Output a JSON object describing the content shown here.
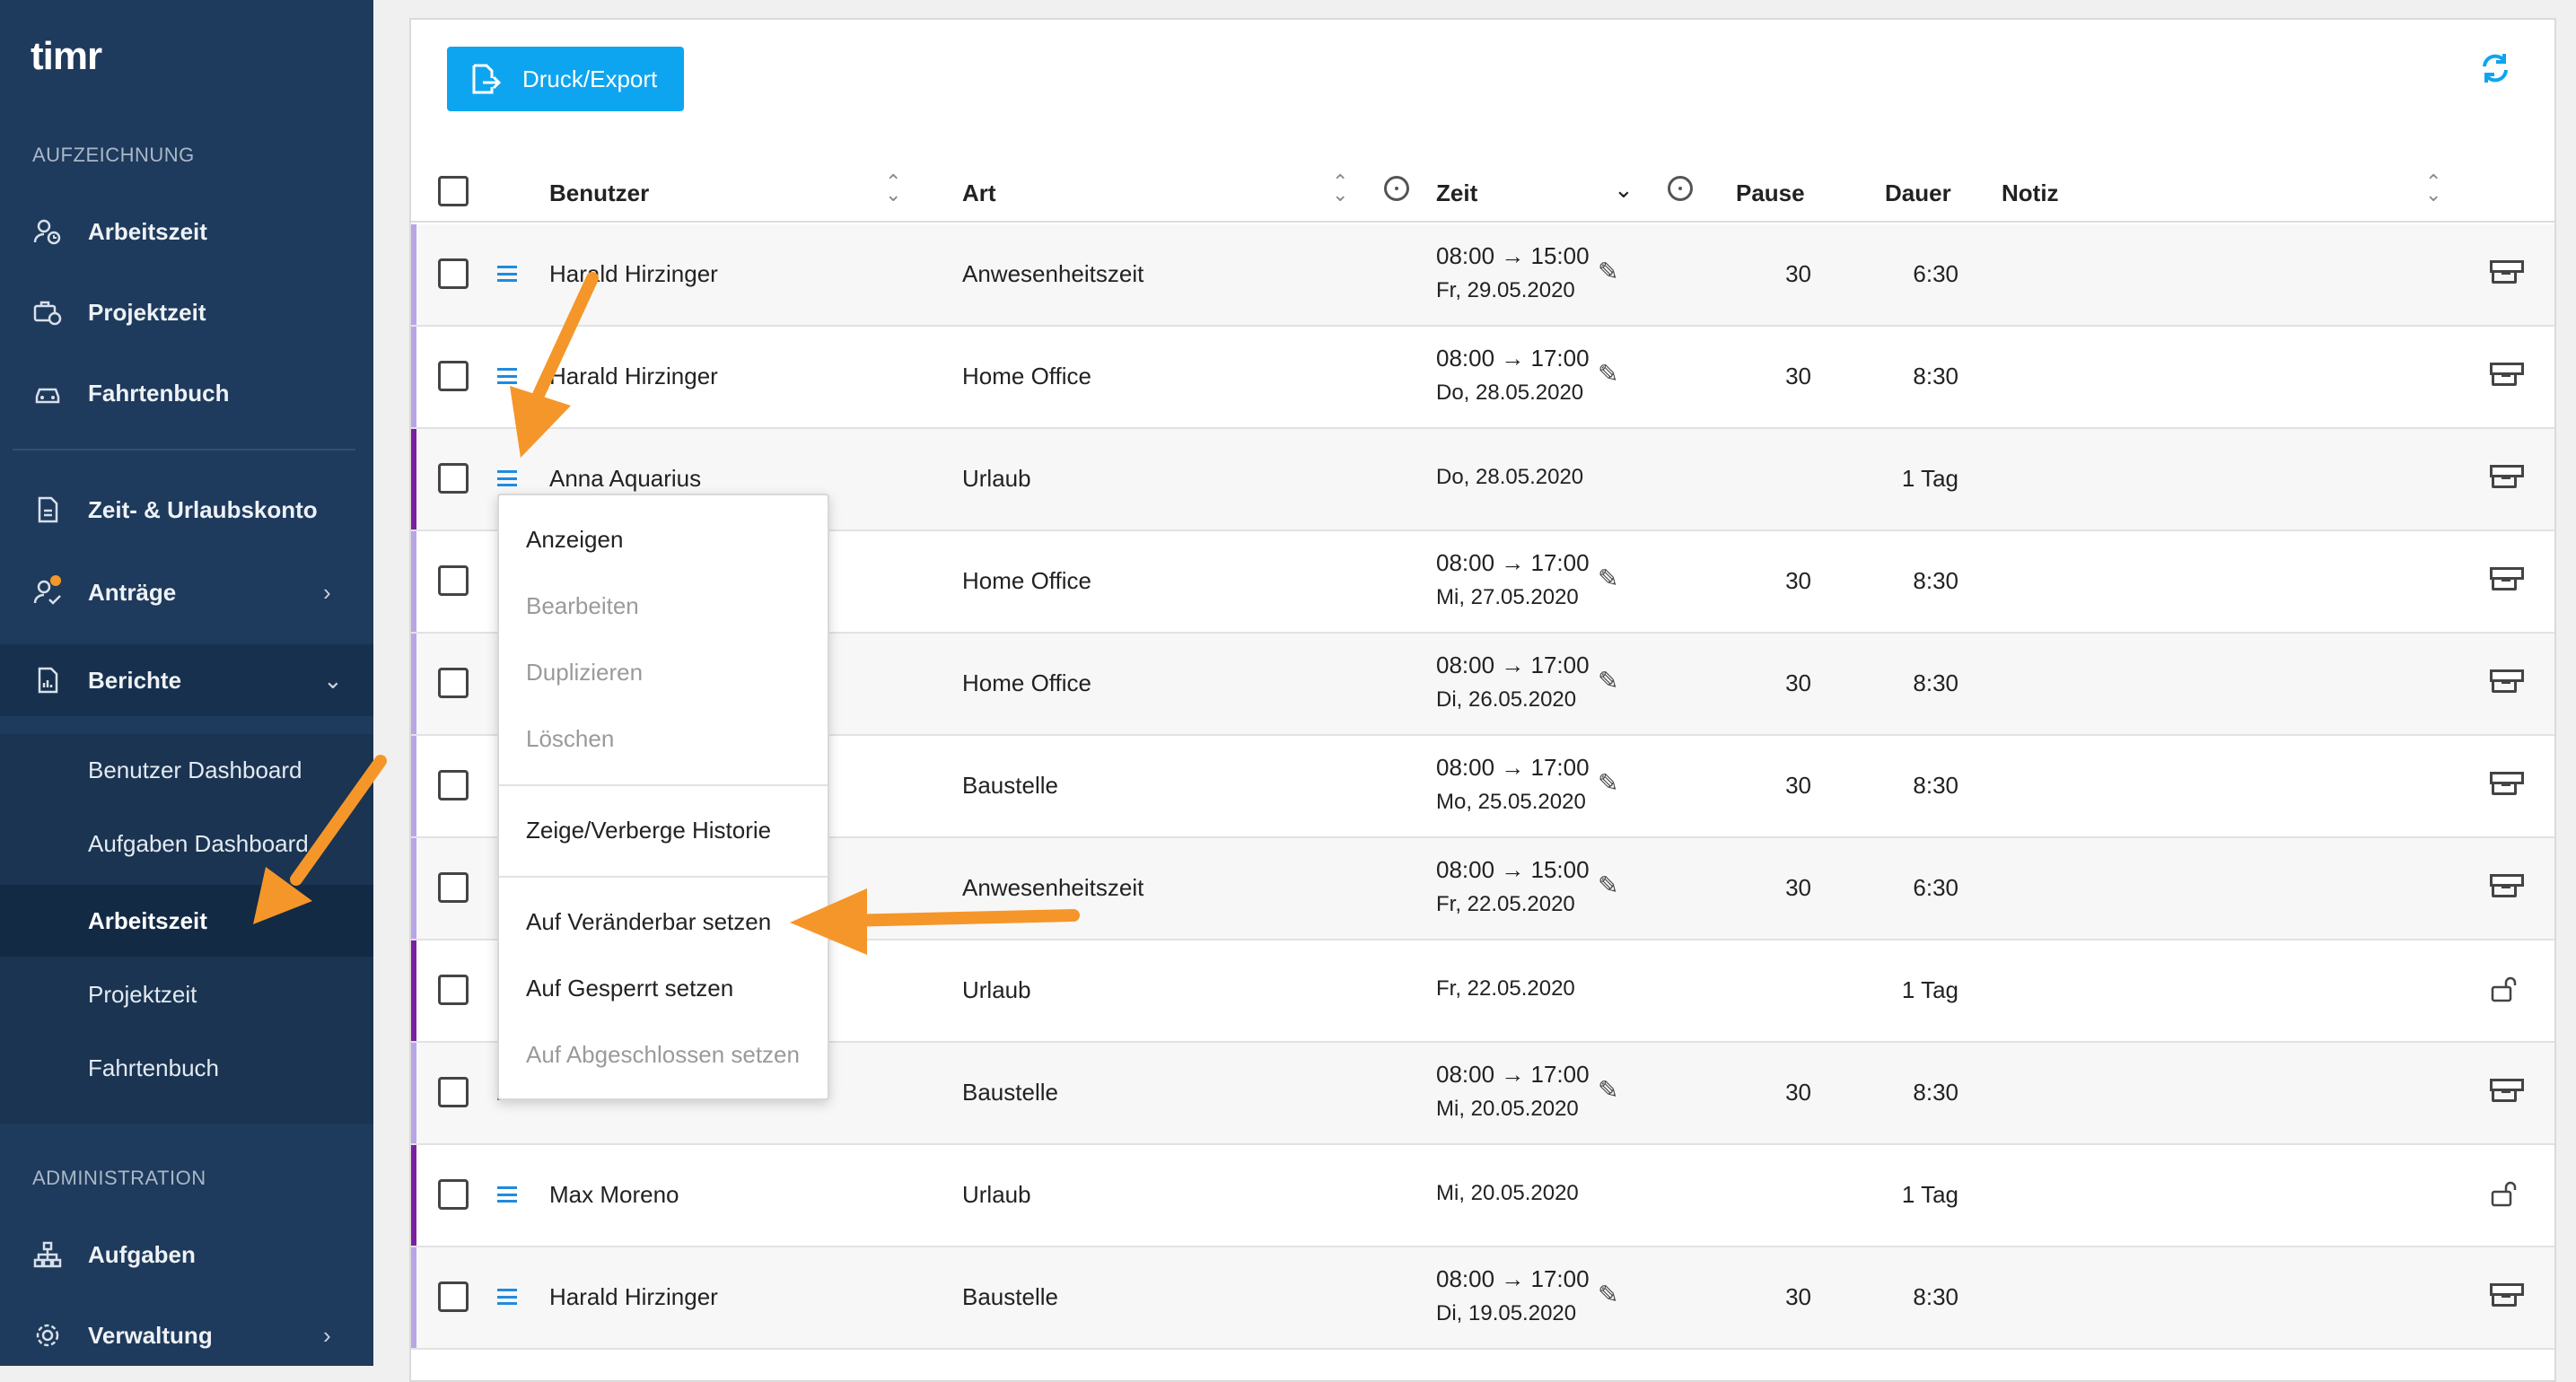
{
  "app": {
    "logo": "timr"
  },
  "sidebar": {
    "section_record": "AUFZEICHNUNG",
    "section_admin": "ADMINISTRATION",
    "items": [
      {
        "label": "Arbeitszeit",
        "icon": "user-clock-icon"
      },
      {
        "label": "Projektzeit",
        "icon": "briefcase-clock-icon"
      },
      {
        "label": "Fahrtenbuch",
        "icon": "car-icon"
      },
      {
        "label": "Zeit- & Urlaubskonto",
        "icon": "account-document-icon"
      },
      {
        "label": "Anträge",
        "icon": "user-check-icon"
      },
      {
        "label": "Berichte",
        "icon": "report-icon"
      },
      {
        "label": "Aufgaben",
        "icon": "hierarchy-icon"
      },
      {
        "label": "Verwaltung",
        "icon": "gear-icon"
      }
    ],
    "reports_sub": [
      "Benutzer Dashboard",
      "Aufgaben Dashboard",
      "Arbeitszeit",
      "Projektzeit",
      "Fahrtenbuch"
    ]
  },
  "toolbar": {
    "export_label": "Druck/Export"
  },
  "table": {
    "headers": {
      "user": "Benutzer",
      "type": "Art",
      "time": "Zeit",
      "pause": "Pause",
      "duration": "Dauer",
      "note": "Notiz"
    },
    "rows": [
      {
        "user": "Harald Hirzinger",
        "type": "Anwesenheitszeit",
        "time": "08:00 → 15:00",
        "date": "Fr, 29.05.2020",
        "pause": "30",
        "duration": "6:30",
        "status": "archived",
        "bar": "#b7a5e8"
      },
      {
        "user": "Harald Hirzinger",
        "type": "Home Office",
        "time": "08:00 → 17:00",
        "date": "Do, 28.05.2020",
        "pause": "30",
        "duration": "8:30",
        "status": "archived",
        "bar": "#b7a5e8"
      },
      {
        "user": "Anna Aquarius",
        "type": "Urlaub",
        "time": "",
        "date": "Do, 28.05.2020",
        "pause": "",
        "duration": "1 Tag",
        "status": "archived",
        "bar": "#7b1fa2"
      },
      {
        "user": "",
        "type": "Home Office",
        "time": "08:00 → 17:00",
        "date": "Mi, 27.05.2020",
        "pause": "30",
        "duration": "8:30",
        "status": "archived",
        "bar": "#b7a5e8"
      },
      {
        "user": "",
        "type": "Home Office",
        "time": "08:00 → 17:00",
        "date": "Di, 26.05.2020",
        "pause": "30",
        "duration": "8:30",
        "status": "archived",
        "bar": "#b7a5e8"
      },
      {
        "user": "",
        "type": "Baustelle",
        "time": "08:00 → 17:00",
        "date": "Mo, 25.05.2020",
        "pause": "30",
        "duration": "8:30",
        "status": "archived",
        "bar": "#b7a5e8"
      },
      {
        "user": "",
        "type": "Anwesenheitszeit",
        "time": "08:00 → 15:00",
        "date": "Fr, 22.05.2020",
        "pause": "30",
        "duration": "6:30",
        "status": "archived",
        "bar": "#b7a5e8"
      },
      {
        "user": "",
        "type": "Urlaub",
        "time": "",
        "date": "Fr, 22.05.2020",
        "pause": "",
        "duration": "1 Tag",
        "status": "unlocked",
        "bar": "#7b1fa2"
      },
      {
        "user": "",
        "type": "Baustelle",
        "time": "08:00 → 17:00",
        "date": "Mi, 20.05.2020",
        "pause": "30",
        "duration": "8:30",
        "status": "archived",
        "bar": "#b7a5e8"
      },
      {
        "user": "Max Moreno",
        "type": "Urlaub",
        "time": "",
        "date": "Mi, 20.05.2020",
        "pause": "",
        "duration": "1 Tag",
        "status": "unlocked",
        "bar": "#7b1fa2"
      },
      {
        "user": "Harald Hirzinger",
        "type": "Baustelle",
        "time": "08:00 → 17:00",
        "date": "Di, 19.05.2020",
        "pause": "30",
        "duration": "8:30",
        "status": "archived",
        "bar": "#b7a5e8"
      }
    ]
  },
  "context_menu": {
    "items": [
      {
        "label": "Anzeigen",
        "enabled": true
      },
      {
        "label": "Bearbeiten",
        "enabled": false
      },
      {
        "label": "Duplizieren",
        "enabled": false
      },
      {
        "label": "Löschen",
        "enabled": false
      },
      {
        "label": "Zeige/Verberge Historie",
        "enabled": true
      },
      {
        "label": "Auf Veränderbar setzen",
        "enabled": true
      },
      {
        "label": "Auf Gesperrt setzen",
        "enabled": true
      },
      {
        "label": "Auf Abgeschlossen setzen",
        "enabled": false
      }
    ]
  },
  "colors": {
    "accent": "#0ea5f0",
    "sidebar": "#1e3a5c",
    "annotation_arrow": "#f5962a"
  }
}
